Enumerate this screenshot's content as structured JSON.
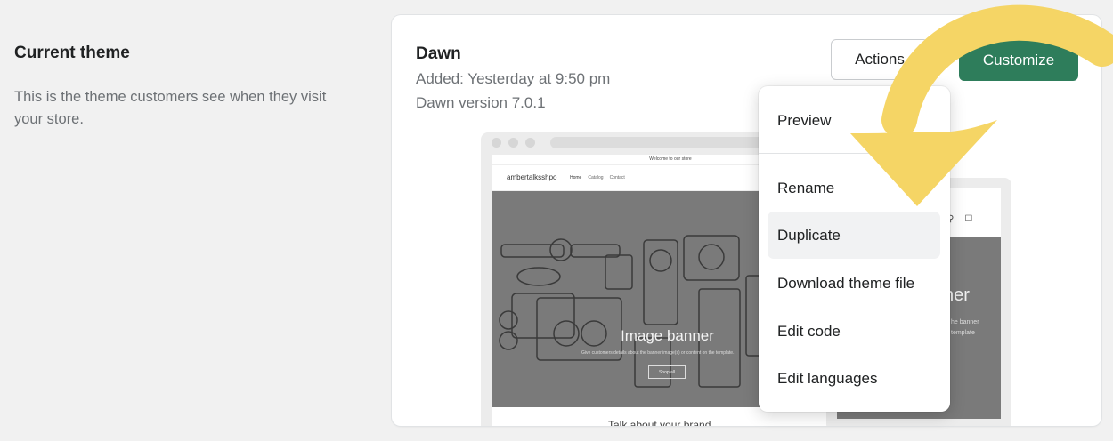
{
  "sidebar": {
    "title": "Current theme",
    "description": "This is the theme customers see when they visit your store."
  },
  "theme": {
    "name": "Dawn",
    "added": "Added: Yesterday at 9:50 pm",
    "version": "Dawn version 7.0.1"
  },
  "buttons": {
    "actions": "Actions",
    "customize": "Customize"
  },
  "preview": {
    "announcement": "Welcome to our store",
    "logo": "ambertalksshpo",
    "nav": [
      "Home",
      "Catalog",
      "Contact"
    ],
    "banner_title": "Image banner",
    "banner_subtitle": "Give customers details about the banner image(s) or content on the template.",
    "banner_button": "Shop all",
    "below_text": "Talk about your brand",
    "mobile_title": "ner",
    "mobile_sub": "he banner template"
  },
  "menu": {
    "items": [
      "Preview",
      "Rename",
      "Duplicate",
      "Download theme file",
      "Edit code",
      "Edit languages"
    ],
    "highlighted": "Duplicate"
  },
  "colors": {
    "customize_bg": "#2e7d5b",
    "annotation_arrow": "#f5d565"
  }
}
